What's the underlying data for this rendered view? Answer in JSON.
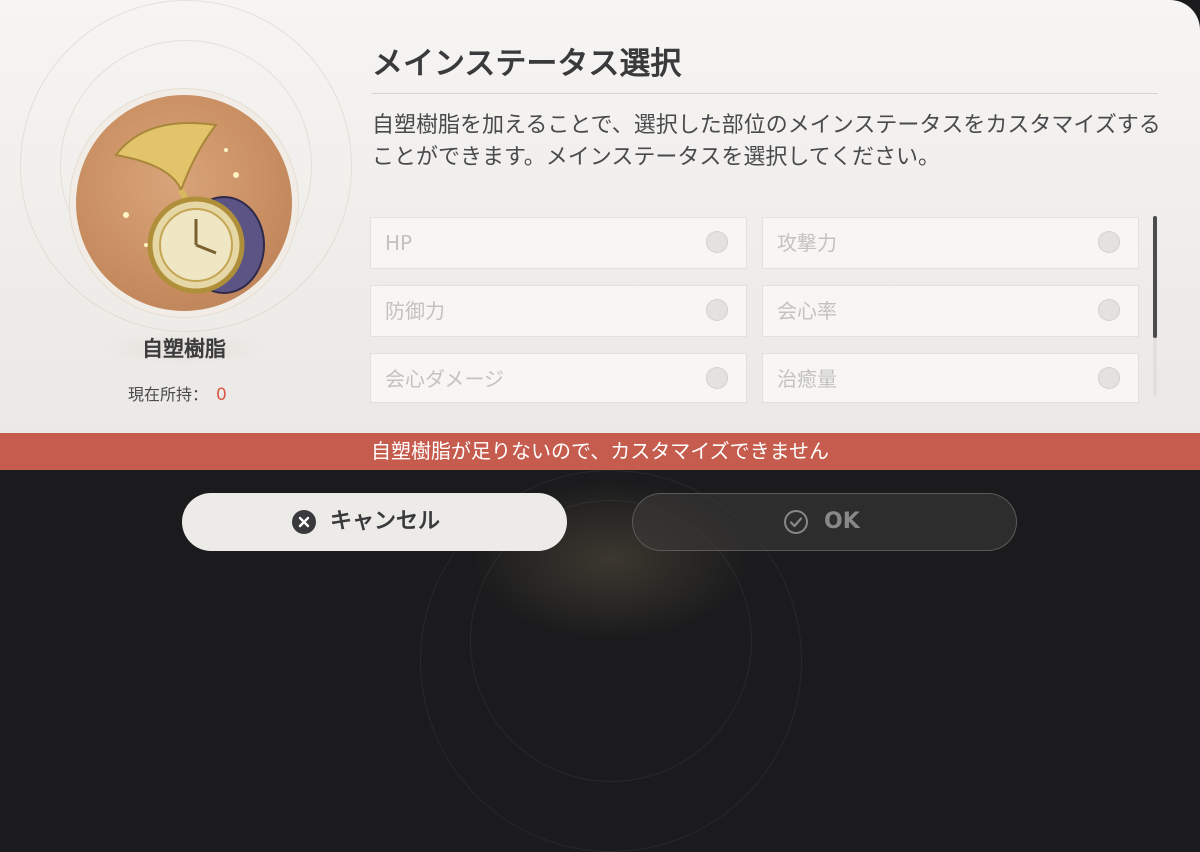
{
  "dialog": {
    "title": "メインステータス選択",
    "description": "自塑樹脂を加えることで、選択した部位のメインステータスをカスタマイズすることができます。メインステータスを選択してください。"
  },
  "item": {
    "icon": "hourglass-pocketwatch-icon",
    "name": "自塑樹脂",
    "owned_label": "現在所持：",
    "owned_count": "0"
  },
  "stat_options": [
    {
      "label": "HP",
      "selected": false
    },
    {
      "label": "攻撃力",
      "selected": false
    },
    {
      "label": "防御力",
      "selected": false
    },
    {
      "label": "会心率",
      "selected": false
    },
    {
      "label": "会心ダメージ",
      "selected": false
    },
    {
      "label": "治癒量",
      "selected": false
    }
  ],
  "warning": "自塑樹脂が足りないので、カスタマイズできません",
  "buttons": {
    "cancel": {
      "label": "キャンセル",
      "icon": "close-circle-icon"
    },
    "ok": {
      "label": "OK",
      "icon": "check-circle-icon"
    }
  },
  "colors": {
    "warning_bg": "#c65c4d",
    "count_red": "#d65a45",
    "panel_bg": "#f2f0ed",
    "bottom_bar": "#1b1b1d"
  }
}
